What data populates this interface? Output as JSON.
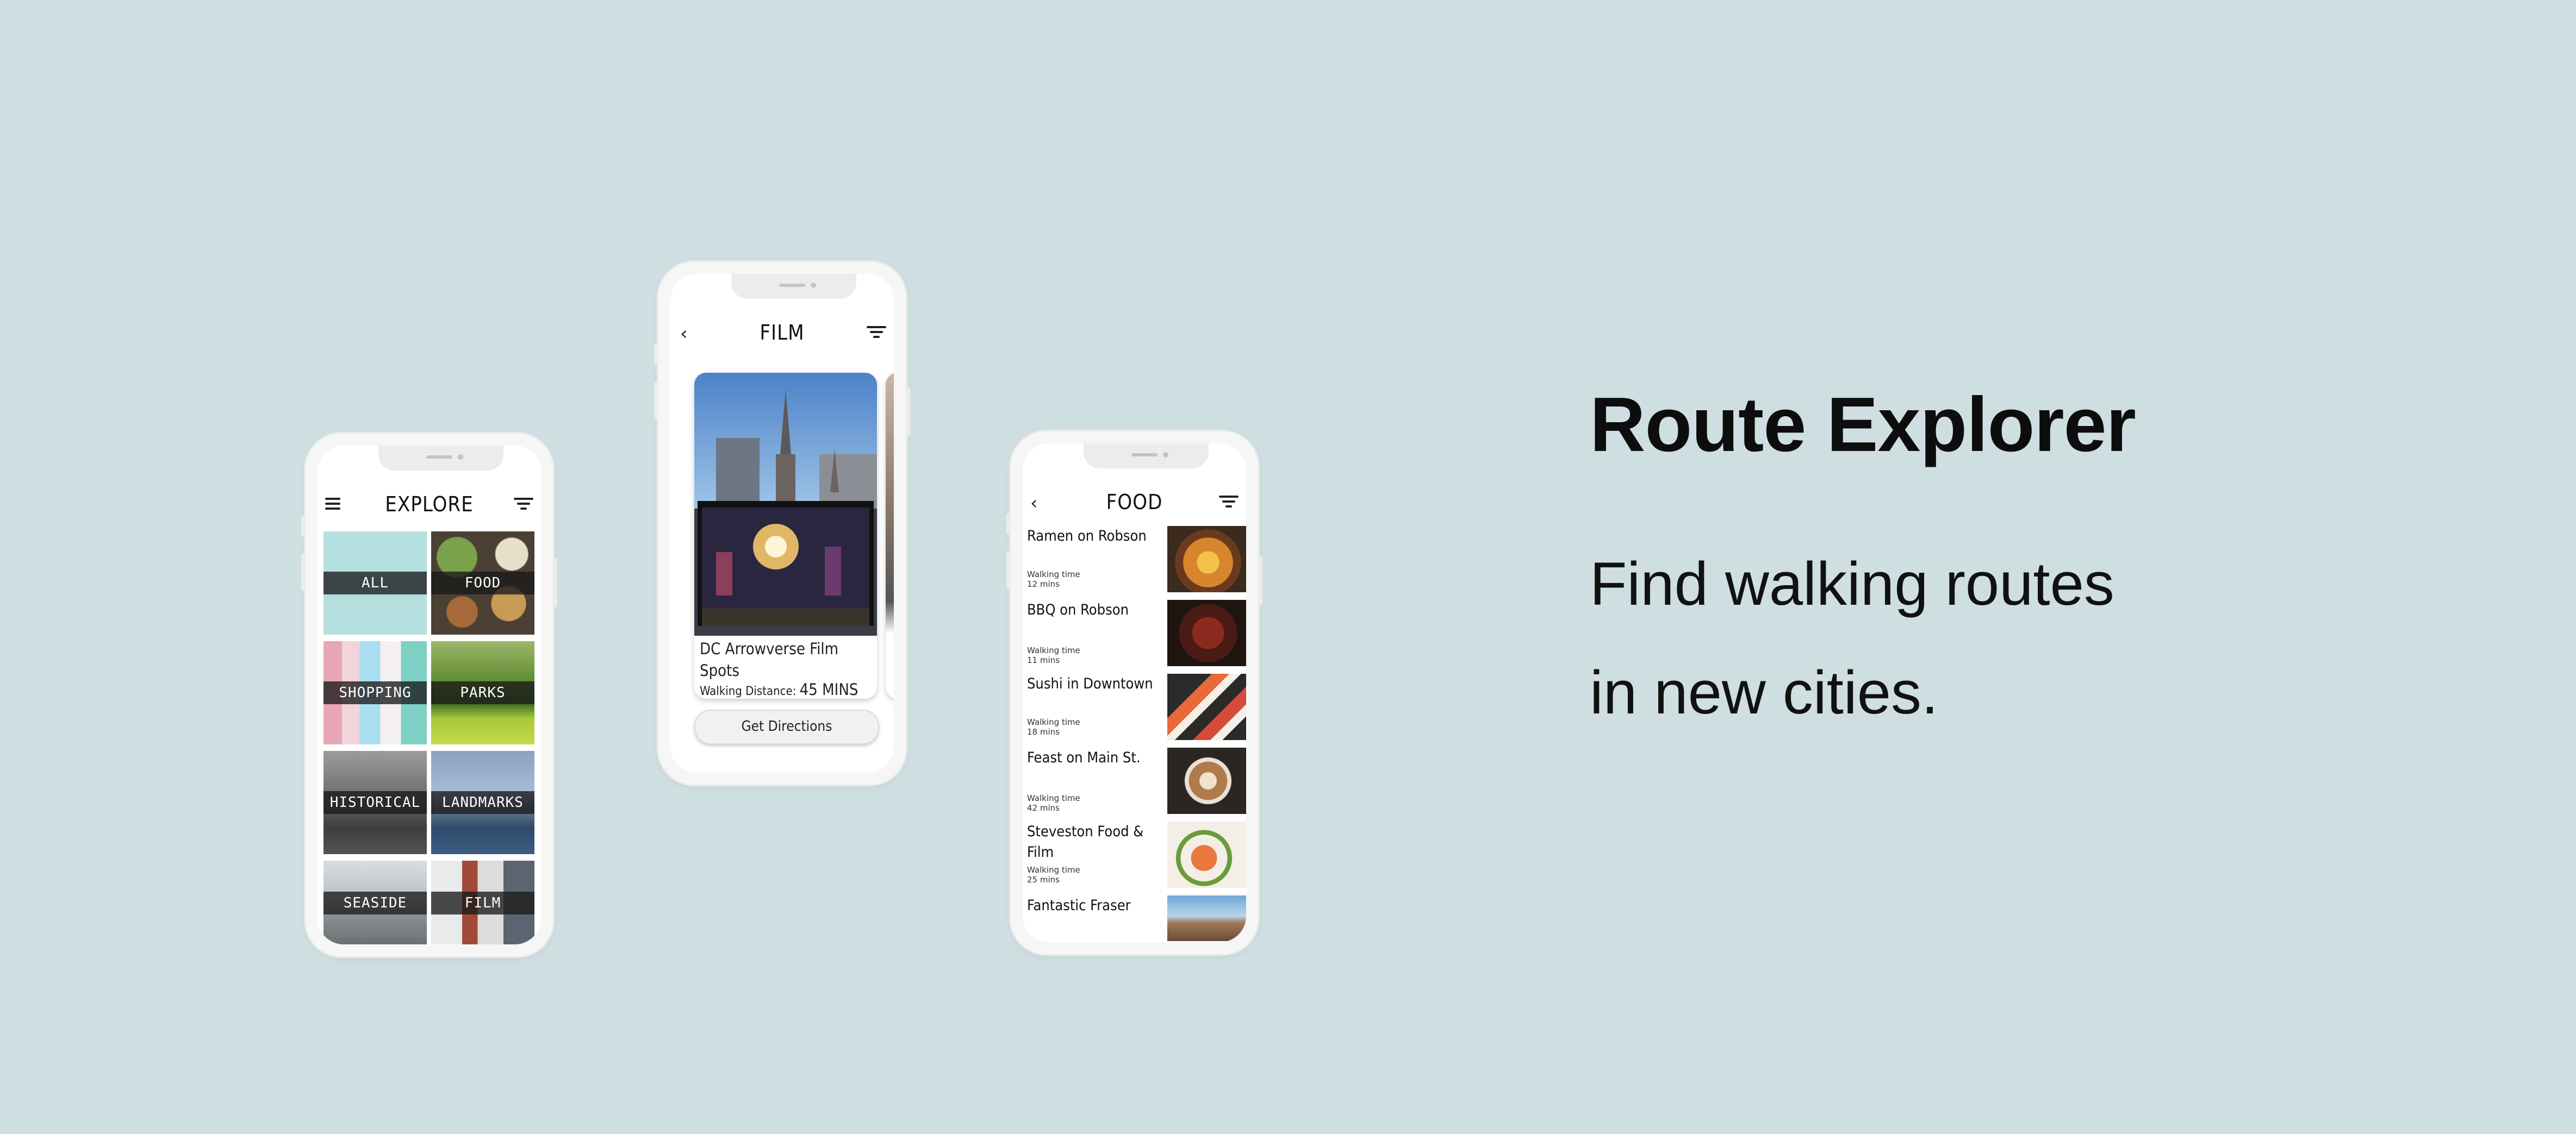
{
  "explore_phone": {
    "title": "EXPLORE",
    "icons": {
      "menu": "menu-icon",
      "filter": "filter-icon"
    },
    "tiles": [
      {
        "label": "ALL"
      },
      {
        "label": "FOOD"
      },
      {
        "label": "SHOPPING"
      },
      {
        "label": "PARKS"
      },
      {
        "label": "HISTORICAL"
      },
      {
        "label": "LANDMARKS"
      },
      {
        "label": "SEASIDE"
      },
      {
        "label": "FILM"
      }
    ]
  },
  "film_phone": {
    "title": "FILM",
    "icons": {
      "back": "back-icon",
      "filter": "filter-icon"
    },
    "card": {
      "name": "DC Arrowverse Film Spots",
      "distance_label": "Walking Distance:",
      "distance_value": "45 MINS"
    },
    "button_label": "Get Directions"
  },
  "food_phone": {
    "title": "FOOD",
    "icons": {
      "back": "back-icon",
      "filter": "filter-icon"
    },
    "items": [
      {
        "name": "Ramen on Robson",
        "walk_label": "Walking time",
        "walk_value": "12 mins"
      },
      {
        "name": "BBQ on Robson",
        "walk_label": "Walking time",
        "walk_value": "11 mins"
      },
      {
        "name": "Sushi in Downtown",
        "walk_label": "Walking time",
        "walk_value": "18 mins"
      },
      {
        "name": "Feast on Main St.",
        "walk_label": "Walking time",
        "walk_value": "42 mins"
      },
      {
        "name": "Steveston Food & Film",
        "walk_label": "Walking time",
        "walk_value": "25 mins"
      },
      {
        "name": "Fantastic Fraser",
        "walk_label": "",
        "walk_value": ""
      }
    ]
  },
  "headline": "Route Explorer",
  "tagline_line1": "Find walking routes",
  "tagline_line2": "in new cities.",
  "colors": {
    "background": "#cfdee1",
    "phone_frame": "#f6f6f6",
    "label_band": "#191919"
  }
}
